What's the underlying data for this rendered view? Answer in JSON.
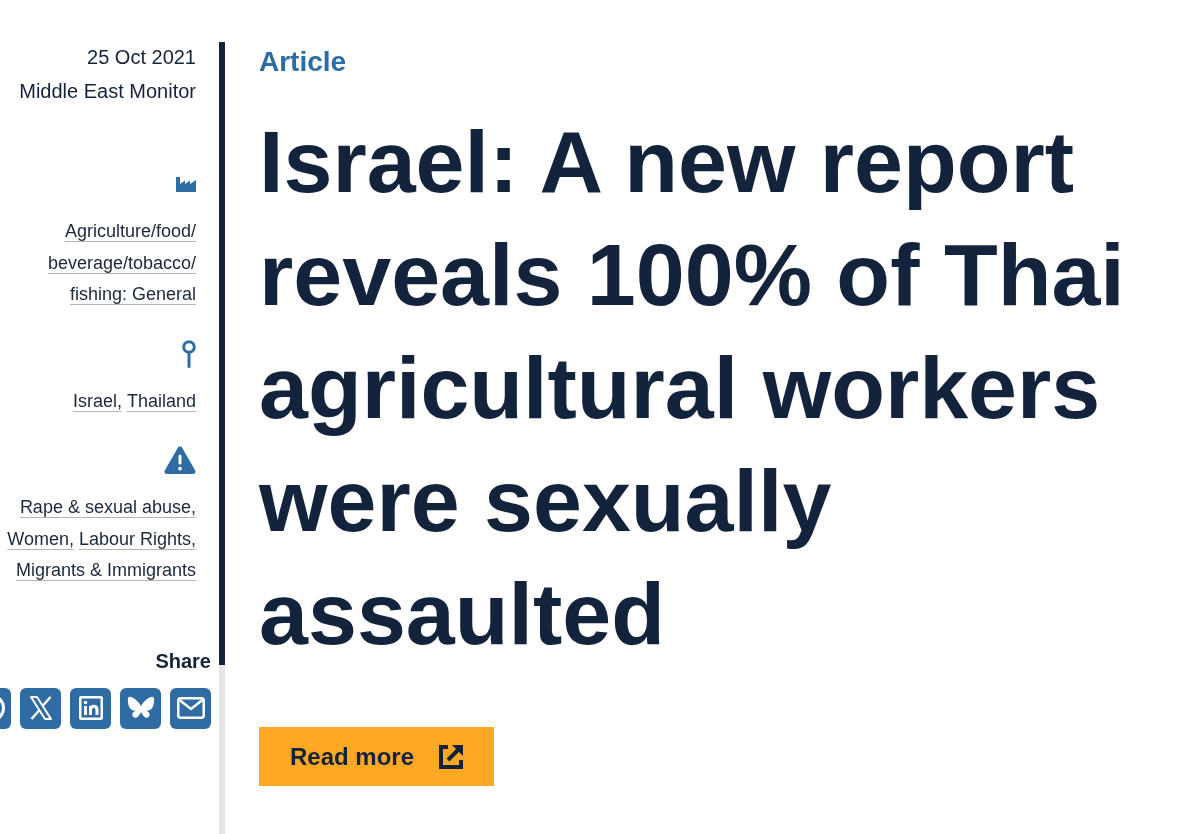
{
  "sidebar": {
    "date": "25 Oct 2021",
    "publisher": "Middle East Monitor",
    "groups": [
      {
        "kind": "sector",
        "links": [
          "Agriculture/food/beverage/tobacco/fishing: General"
        ]
      },
      {
        "kind": "location",
        "links": [
          "Israel,",
          "Thailand"
        ]
      },
      {
        "kind": "issue",
        "links": [
          "Rape & sexual abuse,",
          "Women,",
          "Labour Rights,",
          "Migrants & Immigrants"
        ]
      }
    ],
    "share": {
      "label": "Share",
      "buttons": [
        {
          "kind": "ring"
        },
        {
          "kind": "x"
        },
        {
          "kind": "linkedin"
        },
        {
          "kind": "butterfly"
        },
        {
          "kind": "email"
        }
      ]
    }
  },
  "main": {
    "type_label": "Article",
    "headline": "Israel: A new report reveals 100% of Thai agricultural workers were sexually assaulted",
    "button": {
      "label": "Read more"
    }
  }
}
